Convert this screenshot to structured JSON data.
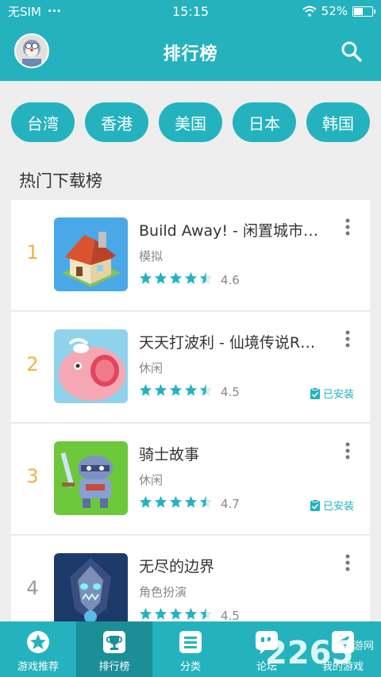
{
  "status_bar": {
    "carrier": "无SIM",
    "signal_dots": "···",
    "time": "15:15",
    "battery": "52%",
    "battery_level": 0.52
  },
  "header": {
    "title": "排行榜",
    "avatar_icon": "avatar-icon",
    "search_icon": "search-icon"
  },
  "regions": [
    "台湾",
    "香港",
    "美国",
    "日本",
    "韩国"
  ],
  "section_title": "热门下载榜",
  "apps": [
    {
      "rank": "1",
      "name": " Build Away! - 闲置城市…",
      "category": "模拟",
      "rating": "4.6",
      "stars": 4.5,
      "installed": ""
    },
    {
      "rank": "2",
      "name": "天天打波利 - 仙境传说R…",
      "category": "休闲",
      "rating": "4.5",
      "stars": 4.5,
      "installed": "已安装"
    },
    {
      "rank": "3",
      "name": "骑士故事",
      "category": "休闲",
      "rating": "4.7",
      "stars": 4.5,
      "installed": "已安装"
    },
    {
      "rank": "4",
      "name": "无尽的边界",
      "category": "角色扮演",
      "rating": "4.5",
      "stars": 4.5,
      "installed": ""
    }
  ],
  "nav": [
    {
      "label": "游戏推荐",
      "icon": "star-icon"
    },
    {
      "label": "排行榜",
      "icon": "trophy-icon"
    },
    {
      "label": "分类",
      "icon": "category-icon"
    },
    {
      "label": "论坛",
      "icon": "forum-icon"
    },
    {
      "label": "我的游戏",
      "icon": "my-games-icon"
    }
  ],
  "watermark": {
    "text": "2265",
    "sub": "手游网"
  },
  "colors": {
    "primary": "#24b3be",
    "rank_gold": "#f2b13c",
    "active_nav": "#1b8f98"
  }
}
